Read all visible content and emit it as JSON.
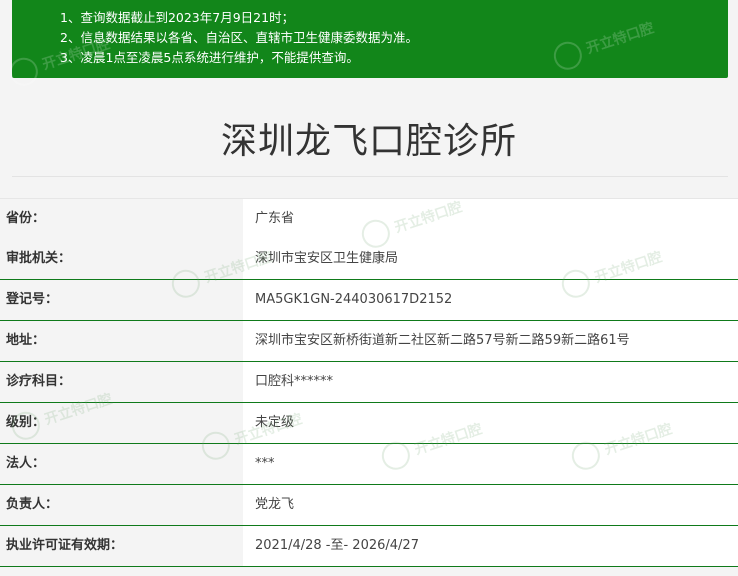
{
  "notice": {
    "lines": [
      "1、查询数据截止到2023年7月9日21时；",
      "2、信息数据结果以各省、自治区、直辖市卫生健康委数据为准。",
      "3、凌晨1点至凌晨5点系统进行维护，不能提供查询。"
    ]
  },
  "title": "深圳龙飞口腔诊所",
  "rows": [
    {
      "label": "省份：",
      "value": "广东省"
    },
    {
      "label": "审批机关：",
      "value": "深圳市宝安区卫生健康局"
    },
    {
      "label": "登记号：",
      "value": "MA5GK1GN-244030617D2152"
    },
    {
      "label": "地址：",
      "value": "深圳市宝安区新桥街道新二社区新二路57号新二路59新二路61号"
    },
    {
      "label": "诊疗科目：",
      "value": "口腔科******"
    },
    {
      "label": "级别：",
      "value": "未定级"
    },
    {
      "label": "法人：",
      "value": "***"
    },
    {
      "label": "负责人：",
      "value": "党龙飞"
    },
    {
      "label": "执业许可证有效期：",
      "value": "2021/4/28 -至- 2026/4/27"
    }
  ],
  "watermark": {
    "text": "开立特口腔"
  },
  "colors": {
    "notice_bg": "#12861a",
    "row_border": "#0f7a1a",
    "title_text": "#333333"
  }
}
